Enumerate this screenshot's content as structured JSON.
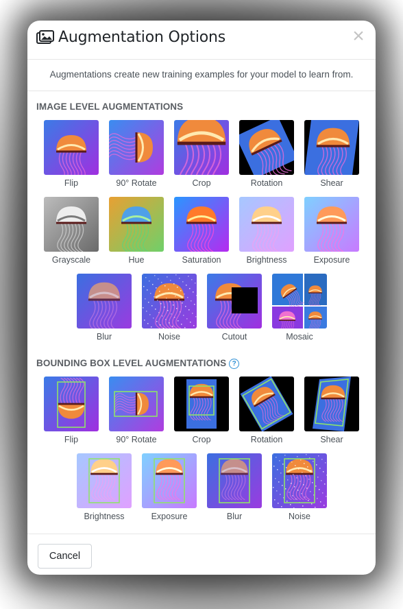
{
  "modal": {
    "title": "Augmentation Options",
    "subtitle": "Augmentations create new training examples for your model to learn from."
  },
  "image_level": {
    "heading": "IMAGE LEVEL AUGMENTATIONS",
    "items": [
      {
        "label": "Flip"
      },
      {
        "label": "90° Rotate"
      },
      {
        "label": "Crop"
      },
      {
        "label": "Rotation"
      },
      {
        "label": "Shear"
      },
      {
        "label": "Grayscale"
      },
      {
        "label": "Hue"
      },
      {
        "label": "Saturation"
      },
      {
        "label": "Brightness"
      },
      {
        "label": "Exposure"
      },
      {
        "label": "Blur"
      },
      {
        "label": "Noise"
      },
      {
        "label": "Cutout"
      },
      {
        "label": "Mosaic"
      }
    ]
  },
  "bbox_level": {
    "heading": "BOUNDING BOX LEVEL AUGMENTATIONS",
    "help_icon": "question-circle-icon",
    "items": [
      {
        "label": "Flip"
      },
      {
        "label": "90° Rotate"
      },
      {
        "label": "Crop"
      },
      {
        "label": "Rotation"
      },
      {
        "label": "Shear"
      },
      {
        "label": "Brightness"
      },
      {
        "label": "Exposure"
      },
      {
        "label": "Blur"
      },
      {
        "label": "Noise"
      }
    ]
  },
  "footer": {
    "cancel_label": "Cancel"
  },
  "colors": {
    "thumb_blue": "#3b6fe0",
    "thumb_purple": "#8a2be2",
    "jelly_orange": "#f08a3c",
    "bbox_green": "#8fe36a"
  }
}
